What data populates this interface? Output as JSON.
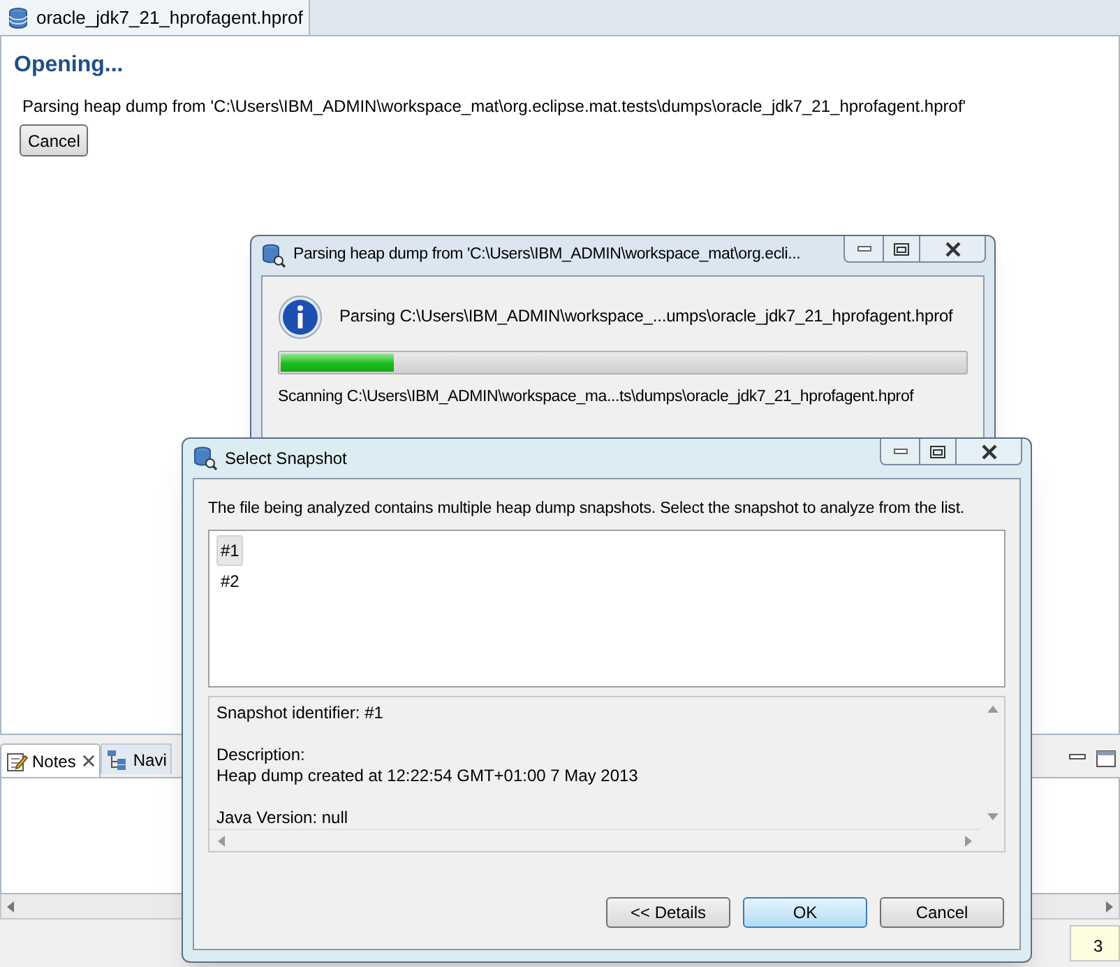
{
  "editor_tab": {
    "title": "oracle_jdk7_21_hprofagent.hprof"
  },
  "opening": {
    "heading": "Opening...",
    "message": "Parsing heap dump from 'C:\\Users\\IBM_ADMIN\\workspace_mat\\org.eclipse.mat.tests\\dumps\\oracle_jdk7_21_hprofagent.hprof'",
    "cancel_button": "Cancel"
  },
  "bottom_panel": {
    "tabs": [
      {
        "label": "Notes",
        "selected": true
      },
      {
        "label": "Navi",
        "selected": false
      }
    ]
  },
  "status_bar": {
    "field": "3"
  },
  "progress_dialog": {
    "title": "Parsing heap dump from 'C:\\Users\\IBM_ADMIN\\workspace_mat\\org.ecli...",
    "message": "Parsing C:\\Users\\IBM_ADMIN\\workspace_...umps\\oracle_jdk7_21_hprofagent.hprof",
    "level": 0.165,
    "status": "Scanning C:\\Users\\IBM_ADMIN\\workspace_ma...ts\\dumps\\oracle_jdk7_21_hprofagent.hprof"
  },
  "snapshot_dialog": {
    "title": "Select Snapshot",
    "instruction": "The file being analyzed contains multiple heap dump snapshots. Select the snapshot to analyze from the list.",
    "snapshots": [
      {
        "label": "#1",
        "selected": true
      },
      {
        "label": "#2",
        "selected": false
      }
    ],
    "details": [
      {
        "lines": [
          "Snapshot identifier: #1"
        ]
      },
      {
        "lines": [
          "Description:",
          "Heap dump created at 12:22:54 GMT+01:00 7 May 2013"
        ]
      },
      {
        "lines": [
          "Java Version: null"
        ]
      }
    ],
    "buttons": [
      {
        "label": "<< Details",
        "default": false
      },
      {
        "label": "OK",
        "default": true
      },
      {
        "label": "Cancel",
        "default": false
      }
    ]
  }
}
